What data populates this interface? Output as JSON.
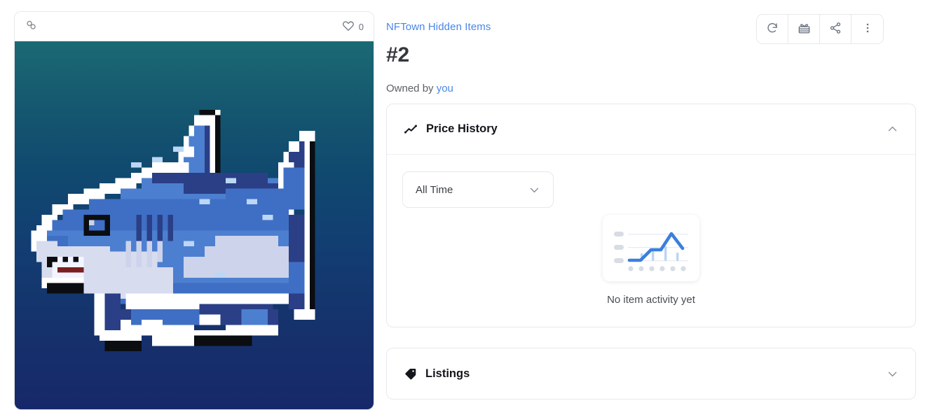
{
  "media_card": {
    "chain_icon": "chain-link-icon",
    "likes": {
      "icon": "heart-icon",
      "count": "0"
    },
    "artwork": {
      "name": "pixel-shark-artwork",
      "background_top": "#1b6a74",
      "background_bottom": "#17286a",
      "palette": {
        "outline_dark": "#0b0d10",
        "outline_light": "#ffffff",
        "body_light": "#cdd3ea",
        "body_mid": "#4c7fd0",
        "body_blue": "#3f6fc4",
        "body_dark": "#2b3f86",
        "belly": "#d8dcef",
        "teeth": "#f2f4ff",
        "gums": "#7a1f22",
        "eye": "#3e6ec6"
      }
    }
  },
  "detail": {
    "collection_link": "NFTown Hidden Items",
    "title": "#2",
    "owner_prefix": "Owned by",
    "owner_link": "you",
    "accent_color": "#4a86e8",
    "actions": [
      {
        "name": "refresh-metadata-button",
        "icon": "refresh-icon"
      },
      {
        "name": "gift-button",
        "icon": "gift-icon"
      },
      {
        "name": "share-button",
        "icon": "share-icon"
      },
      {
        "name": "more-options-button",
        "icon": "more-vertical-icon"
      }
    ]
  },
  "price_history": {
    "icon": "line-chart-icon",
    "title": "Price History",
    "chevron": "chevron-up-icon",
    "expanded": true,
    "range_select": {
      "value": "All Time",
      "chevron": "chevron-down-icon"
    },
    "empty": {
      "illustration": "empty-chart-illustration",
      "text": "No item activity yet"
    }
  },
  "listings": {
    "icon": "price-tag-icon",
    "title": "Listings",
    "chevron": "chevron-down-icon",
    "expanded": false
  },
  "chart_data": {
    "type": "line",
    "title": "Price History",
    "xlabel": "",
    "ylabel": "",
    "categories": [],
    "values": [],
    "series": [],
    "range": "All Time",
    "empty_message": "No item activity yet",
    "placeholder_illustration": {
      "line_points": [
        [
          0,
          0.3
        ],
        [
          0.17,
          0.3
        ],
        [
          0.34,
          0.55
        ],
        [
          0.5,
          0.55
        ],
        [
          0.67,
          0.88
        ],
        [
          0.84,
          0.48
        ]
      ],
      "bar_heights": [
        0.18,
        0.22,
        0.34,
        0.16
      ],
      "gridlines": 3,
      "axis_dots": 6,
      "legend_dots": 3,
      "line_color": "#3b7fdc",
      "bar_color": "#bcd5f2",
      "dot_color": "#d8dce3"
    }
  }
}
